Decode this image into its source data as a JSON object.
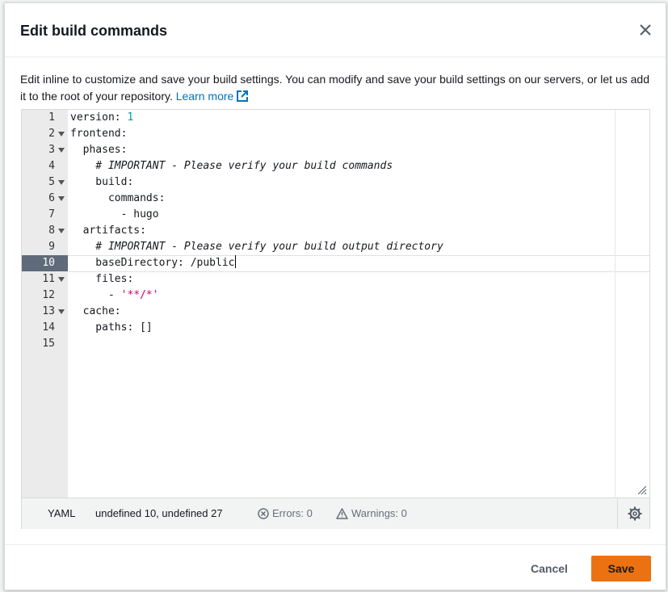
{
  "modal": {
    "title": "Edit build commands",
    "description": "Edit inline to customize and save your build settings. You can modify and save your build settings on our servers, or let us add it to the root of your repository.",
    "learn_more": "Learn more"
  },
  "editor": {
    "lines": [
      {
        "n": "1",
        "fold": false
      },
      {
        "n": "2",
        "fold": true
      },
      {
        "n": "3",
        "fold": true
      },
      {
        "n": "4",
        "fold": false
      },
      {
        "n": "5",
        "fold": true
      },
      {
        "n": "6",
        "fold": true
      },
      {
        "n": "7",
        "fold": false
      },
      {
        "n": "8",
        "fold": true
      },
      {
        "n": "9",
        "fold": false
      },
      {
        "n": "10",
        "fold": false
      },
      {
        "n": "11",
        "fold": true
      },
      {
        "n": "12",
        "fold": false
      },
      {
        "n": "13",
        "fold": true
      },
      {
        "n": "14",
        "fold": false
      },
      {
        "n": "15",
        "fold": false
      }
    ],
    "active_line": "10",
    "code": {
      "l1_key": "version: ",
      "l1_val": "1",
      "l2": "frontend:",
      "l3": "  phases:",
      "l4": "    # IMPORTANT - Please verify your build commands",
      "l5": "    build:",
      "l6": "      commands:",
      "l7": "        - hugo",
      "l8": "  artifacts:",
      "l9": "    # IMPORTANT - Please verify your build output directory",
      "l10": "    baseDirectory: /public",
      "l11": "    files:",
      "l12_prefix": "      - ",
      "l12_str": "'**/*'",
      "l13": "  cache:",
      "l14": "    paths: []",
      "l15": ""
    }
  },
  "statusbar": {
    "language": "YAML",
    "position": "undefined 10, undefined 27",
    "errors": "Errors: 0",
    "warnings": "Warnings: 0"
  },
  "footer": {
    "cancel": "Cancel",
    "save": "Save"
  },
  "colors": {
    "accent": "#ec7211",
    "link": "#0073bb"
  },
  "icons": [
    "close-icon",
    "external-link-icon",
    "fold-arrow-icon",
    "resize-grip-icon",
    "error-icon",
    "warning-icon",
    "gear-icon"
  ]
}
